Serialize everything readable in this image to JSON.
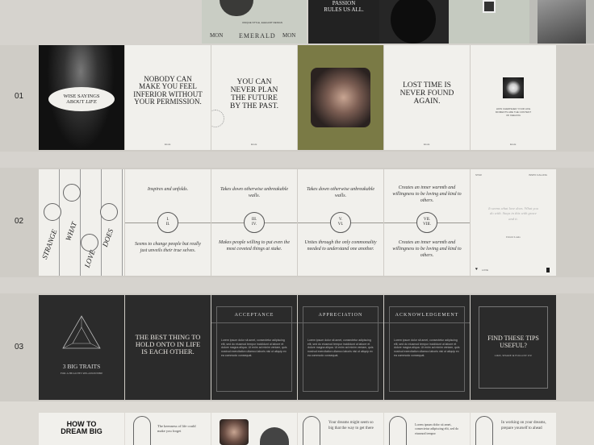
{
  "top_strip": {
    "mon_left": "MON",
    "mon_right": "MON",
    "emerald": "EMERALD",
    "passion": "PASSION RULES US ALL.",
    "tagline": "UNIQUE STYLE, ELEGANT DESIGN"
  },
  "rows": [
    {
      "label": "01"
    },
    {
      "label": "02"
    },
    {
      "label": "03"
    }
  ],
  "row1": {
    "s1_title": "WISE SAYINGS",
    "s1_title2": "ABOUT",
    "s1_title3": "LIFE",
    "s2_quote": "NOBODY CAN MAKE YOU FEEL INFERIOR WITHOUT YOUR PERMISSION.",
    "s3_quote": "YOU CAN NEVER PLAN THE FUTURE BY THE PAST.",
    "s5_quote": "LOST TIME IS NEVER FOUND AGAIN.",
    "s6_caption": "HOW CHERISHED YOUR LIFE MOMENTS ARE THE CONTENT OF FEELING",
    "footer": "ELLE"
  },
  "row2": {
    "s1_words": [
      "STRANGE",
      "WHAT",
      "LOVE",
      "DOES"
    ],
    "top_texts": [
      "Inspires and unfolds.",
      "Takes down otherwise unbreakable walls.",
      "Takes down otherwise unbreakable walls.",
      "Creates an inner warmth and willingness to be loving and kind to others."
    ],
    "numerals": [
      [
        "I.",
        "II."
      ],
      [
        "III.",
        "IV."
      ],
      [
        "V.",
        "VI."
      ],
      [
        "VII.",
        "VIII."
      ]
    ],
    "bottom_texts": [
      "Seems to change people but really just unveils their true selves.",
      "Makes people willing to put even the most coveted things at stake.",
      "Unites through the only commonality needed to understand one another.",
      "Creates an inner warmth and willingness to be loving and kind to others."
    ],
    "s6_quote": "It seems what love does. What you do with. Stays in this with grace and it.",
    "s6_author": "David Louis",
    "s6_header_left": "STAR",
    "s6_header_right": "INSPO CALLING",
    "s6_footer": "LOVE"
  },
  "row3": {
    "s1_title": "3 BIG TRAITS",
    "s1_sub": "FOR A HEALTHY RELATIONSHIP",
    "s2_quote": "THE BEST THING TO HOLD ONTO IN LIFE IS EACH OTHER.",
    "headings": [
      "ACCEPTANCE",
      "APPRECIATION",
      "ACKNOWLEDGEMENT"
    ],
    "lorem": "Lorem ipsum dolor sit amet, consectetur adipiscing elit, sed do eiusmod tempor incididunt ut labore et dolore magna aliqua. Ut enim ad minim veniam, quis nostrud exercitation ullamco laboris nisi ut aliquip ex ea commodo consequat.",
    "s6_title": "FIND THESE TIPS USEFUL?",
    "s6_sub": "LIKE, SHARE & FOLLOW US!"
  },
  "row4": {
    "s1_title": "HOW TO DREAM BIG",
    "s2_text": "The keenness of life could make you forget",
    "s4_text": "Your dreams might seem so big that the way to get there",
    "s5_text": "Lorem ipsum dolor sit amet, consectetur adipiscing elit, sed do eiusmod tempor",
    "s6_text": "In working on your dreams, prepare yourself to ahead"
  },
  "colors": {
    "background": "#d6d3ce",
    "slide_light": "#f1f0ec",
    "slide_dark": "#2b2b2b",
    "olive": "#7a7a45"
  }
}
